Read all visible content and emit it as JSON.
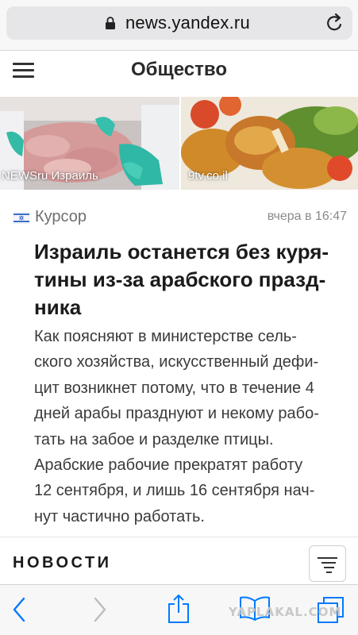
{
  "browser": {
    "url": "news.yandex.ru",
    "icons": {
      "lock": "lock-icon",
      "reload": "reload-icon"
    }
  },
  "header": {
    "title": "Общество",
    "menu_icon": "hamburger-menu-icon"
  },
  "photos": [
    {
      "caption": "NEWSru Израиль"
    },
    {
      "caption": "9tv.co.il"
    }
  ],
  "article": {
    "source": "Курсор",
    "source_icon": "israel-flag-icon",
    "timestamp": "вчера в 16:47",
    "headline_lines": [
      "Израиль останется без куря-",
      "тины из-за арабского празд-",
      "ника"
    ],
    "body_lines": [
      "Как поясняют в министерстве сель-",
      "ского хозяйства, искусственный дефи-",
      "цит возникнет потому, что в течение 4",
      "дней арабы празднуют и некому рабо-",
      "тать на забое и разделке птицы.",
      "Арабские рабочие прекратят работу",
      "12 сентября, и лишь 16 сентября нач-",
      "нут частично работать."
    ]
  },
  "section": {
    "title": "НОВОСТИ",
    "filter_icon": "filter-lines-icon"
  },
  "toolbar": {
    "icons": [
      "back-icon",
      "forward-icon",
      "share-icon",
      "bookmarks-icon",
      "tabs-icon"
    ]
  },
  "watermark": "YAPLAKAL.COM",
  "colors": {
    "accent": "#007aff",
    "text": "#1c1c1c",
    "muted": "#8a8a8a"
  }
}
